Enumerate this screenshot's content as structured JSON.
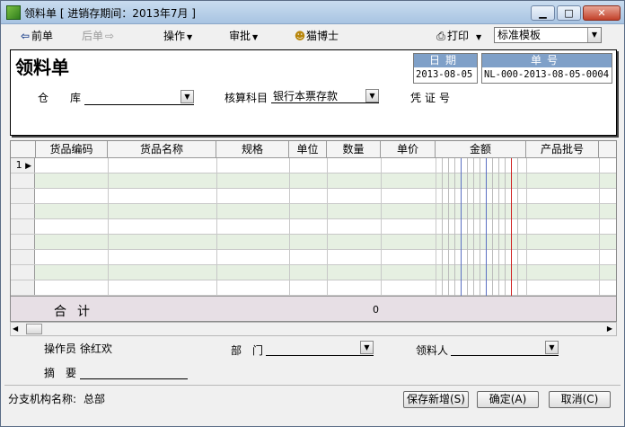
{
  "window": {
    "title": "领料单 [ 进销存期间：2013年7月 ]",
    "min_glyph": "▁",
    "max_glyph": "□",
    "close_glyph": "✕"
  },
  "toolbar": {
    "prev_label": "前单",
    "next_label": "后单",
    "operate_label": "操作",
    "approve_label": "审批",
    "assistant_label": "猫博士",
    "print_label": "打印",
    "template_value": "标准模板",
    "dropdown_glyph": "▼"
  },
  "form": {
    "title": "领料单",
    "date_caption": "日期",
    "date_value": "2013-08-05",
    "number_caption": "单号",
    "number_value": "NL-000-2013-08-05-0004",
    "warehouse_label": "仓　　库",
    "warehouse_value": "",
    "account_label": "核算科目",
    "account_value": "银行本票存款",
    "voucher_label": "凭证号",
    "voucher_value": ""
  },
  "grid": {
    "columns": [
      "货品编码",
      "货品名称",
      "规格",
      "单位",
      "数量",
      "单价",
      "金额",
      "产品批号"
    ],
    "rows": [
      {
        "n": "1",
        "current": true
      },
      {
        "n": ""
      },
      {
        "n": ""
      },
      {
        "n": ""
      },
      {
        "n": ""
      },
      {
        "n": ""
      },
      {
        "n": ""
      },
      {
        "n": ""
      },
      {
        "n": ""
      }
    ],
    "total_label": "合计",
    "total_quantity": "0",
    "row_marker": "▶"
  },
  "footer": {
    "operator_label": "操作员",
    "operator_value": "徐红欢",
    "department_label": "部　门",
    "department_value": "",
    "receiver_label": "领料人",
    "receiver_value": "",
    "summary_label": "摘　要",
    "summary_value": "",
    "branch_label": "分支机构名称:",
    "branch_value": "总部",
    "save_new_label": "保存新增(S)",
    "ok_label": "确定(A)",
    "cancel_label": "取消(C)"
  },
  "colors": {
    "header_caption_bg": "#7fa0c8",
    "alt_row": "#e6f0e2",
    "total_bg": "#e7dfe5",
    "money_line_blue": "#5a6fc2",
    "money_line_red": "#d02020"
  }
}
